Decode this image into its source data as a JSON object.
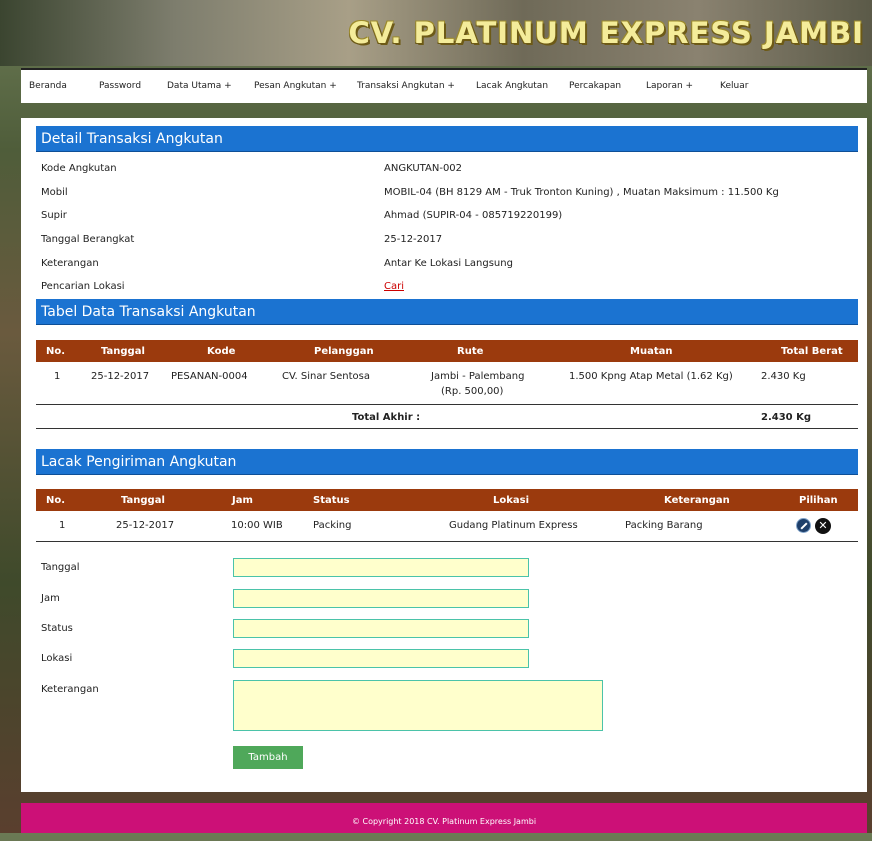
{
  "header": {
    "title": "CV. PLATINUM EXPRESS JAMBI"
  },
  "nav": {
    "items": [
      "Beranda",
      "Password",
      "Data Utama +",
      "Pesan Angkutan +",
      "Transaksi Angkutan +",
      "Lacak Angkutan",
      "Percakapan",
      "Laporan +",
      "Keluar"
    ]
  },
  "detail": {
    "title": "Detail Transaksi Angkutan",
    "fields": [
      {
        "label": "Kode Angkutan",
        "value": "ANGKUTAN-002"
      },
      {
        "label": "Mobil",
        "value": "MOBIL-04 (BH 8129 AM - Truk Tronton Kuning) , Muatan Maksimum : 11.500 Kg"
      },
      {
        "label": "Supir",
        "value": "Ahmad (SUPIR-04 - 085719220199)"
      },
      {
        "label": "Tanggal Berangkat",
        "value": "25-12-2017"
      },
      {
        "label": "Keterangan",
        "value": "Antar Ke Lokasi Langsung"
      },
      {
        "label": "Pencarian Lokasi",
        "value": "Cari"
      }
    ]
  },
  "transaksi": {
    "title": "Tabel Data Transaksi Angkutan",
    "headers": [
      "No.",
      "Tanggal",
      "Kode",
      "Pelanggan",
      "Rute",
      "Muatan",
      "Total Berat"
    ],
    "rows": [
      {
        "no": "1",
        "tanggal": "25-12-2017",
        "kode": "PESANAN-0004",
        "pelanggan": "CV. Sinar Sentosa",
        "rute": "Jambi - Palembang",
        "rute_harga": "(Rp. 500,00)",
        "muatan": "1.500 Kpng Atap Metal (1.62 Kg)",
        "total_berat": "2.430 Kg"
      }
    ],
    "total_label": "Total Akhir :",
    "total_value": "2.430 Kg"
  },
  "lacak": {
    "title": "Lacak Pengiriman Angkutan",
    "headers": [
      "No.",
      "Tanggal",
      "Jam",
      "Status",
      "Lokasi",
      "Keterangan",
      "Pilihan"
    ],
    "rows": [
      {
        "no": "1",
        "tanggal": "25-12-2017",
        "jam": "10:00 WIB",
        "status": "Packing",
        "lokasi": "Gudang Platinum Express",
        "keterangan": "Packing Barang"
      }
    ]
  },
  "form": {
    "labels": [
      "Tanggal",
      "Jam",
      "Status",
      "Lokasi",
      "Keterangan"
    ],
    "submit": "Tambah"
  },
  "footer": {
    "text": "© Copyright 2018 CV. Platinum Express Jambi"
  },
  "icons": {
    "edit": "edit-icon",
    "delete": "delete-icon"
  },
  "colors": {
    "section_head": "#1b73d1",
    "table_head": "#9b3a0d",
    "footer": "#cc1077",
    "button": "#4fa85a"
  }
}
